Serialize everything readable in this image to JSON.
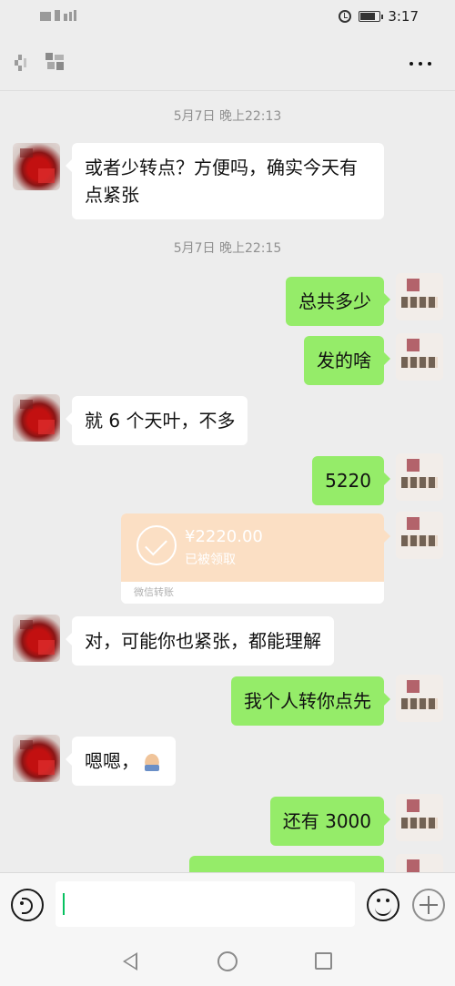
{
  "status_bar": {
    "time": "3:17"
  },
  "chat": {
    "messages": [
      {
        "kind": "timestamp",
        "text": "5月7日 晚上22:13"
      },
      {
        "kind": "text",
        "side": "left",
        "text": "或者少转点？方便吗，确实今天有点紧张"
      },
      {
        "kind": "timestamp",
        "text": "5月7日 晚上22:15"
      },
      {
        "kind": "text",
        "side": "right",
        "text": "总共多少"
      },
      {
        "kind": "text",
        "side": "right",
        "text": "发的啥"
      },
      {
        "kind": "text",
        "side": "left",
        "text": "就 6 个天叶，不多"
      },
      {
        "kind": "text",
        "side": "right",
        "text": "5220"
      },
      {
        "kind": "transfer",
        "side": "right",
        "amount": "¥2220.00",
        "status": "已被领取",
        "label": "微信转账"
      },
      {
        "kind": "text",
        "side": "left",
        "text": "对，可能你也紧张，都能理解"
      },
      {
        "kind": "text",
        "side": "right",
        "text": "我个人转你点先"
      },
      {
        "kind": "text",
        "side": "left",
        "text": "嗯嗯，",
        "emoji": "pray-emoji"
      },
      {
        "kind": "text",
        "side": "right",
        "text": "还有 3000"
      }
    ]
  },
  "icons": {
    "back": "back-icon",
    "more": "more-icon",
    "voice": "voice-icon",
    "emoji": "emoji-icon",
    "plus": "plus-icon"
  },
  "colors": {
    "background": "#ededed",
    "sent_bubble": "#95ec69",
    "received_bubble": "#ffffff",
    "transfer_card": "#fbdfc4",
    "caret": "#07c160"
  }
}
